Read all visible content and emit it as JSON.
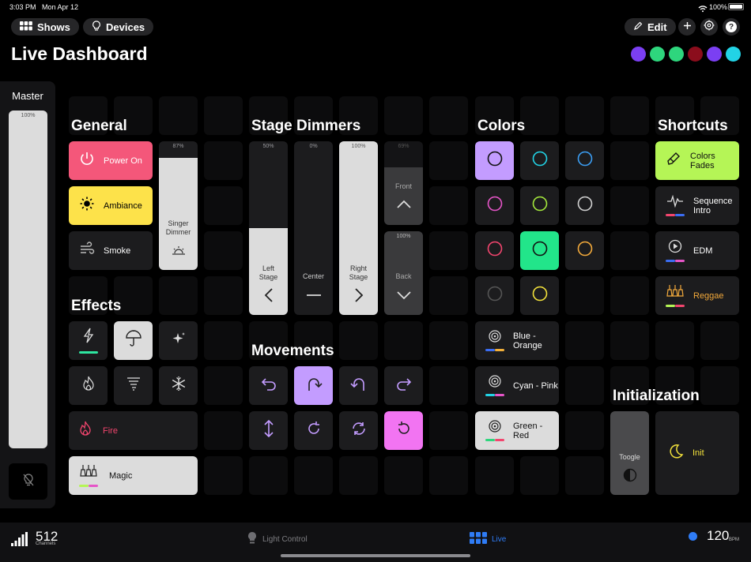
{
  "status_bar": {
    "time": "3:03 PM",
    "date": "Mon Apr 12",
    "battery": "100%"
  },
  "toolbar": {
    "shows_label": "Shows",
    "devices_label": "Devices",
    "edit_label": "Edit"
  },
  "page_title": "Live Dashboard",
  "header_colors": [
    "#7b3ff2",
    "#2ed67d",
    "#2ed67d",
    "#8b0d1c",
    "#7b3ff2",
    "#22d3e6"
  ],
  "master": {
    "title": "Master",
    "percent": "100%",
    "level": 1.0
  },
  "sections": {
    "general": "General",
    "stage_dimmers": "Stage Dimmers",
    "colors": "Colors",
    "shortcuts": "Shortcuts",
    "effects": "Effects",
    "movements": "Movements",
    "initialization": "Initialization"
  },
  "general": {
    "power_on": "Power On",
    "ambiance": "Ambiance",
    "smoke": "Smoke",
    "singer_dimmer": {
      "label": "Singer Dimmer",
      "percent": "87%",
      "level": 0.87
    }
  },
  "stage_dimmers": {
    "left": {
      "label": "Left Stage",
      "percent": "50%",
      "level": 0.5
    },
    "center": {
      "label": "Center",
      "percent": "0%",
      "level": 0
    },
    "right": {
      "label": "Right Stage",
      "percent": "100%",
      "level": 1.0
    },
    "front": {
      "label": "Front",
      "percent": "69%",
      "level": 0.69
    },
    "back": {
      "label": "Back",
      "percent": "100%",
      "level": 1.0
    }
  },
  "colors_grid": {
    "presets": [
      "Blue - Orange",
      "Cyan - Pink",
      "Green - Red"
    ],
    "circle_colors": [
      "#1e1e20",
      "#22d3e6",
      "#3b9df2",
      "#e655c8",
      "#a4e83c",
      "#d0d0d0",
      "#f2456e",
      "#111111",
      "#f2a93b",
      "#555555",
      "#f2e13b"
    ],
    "selected_1": "#c39cff",
    "selected_2": "#22e58a"
  },
  "shortcuts": {
    "colors_fades": "Colors Fades",
    "sequence_intro": "Sequence Intro",
    "edm": "EDM",
    "reggae": "Reggae"
  },
  "effects": {
    "fire": "Fire",
    "magic": "Magic"
  },
  "initialization": {
    "toggle": "Toogle",
    "init": "Init"
  },
  "bottom_bar": {
    "channels_count": "512",
    "channels_label": "Channels",
    "light_control": "Light Control",
    "live": "Live",
    "bpm_value": "120",
    "bpm_label": "BPM"
  }
}
